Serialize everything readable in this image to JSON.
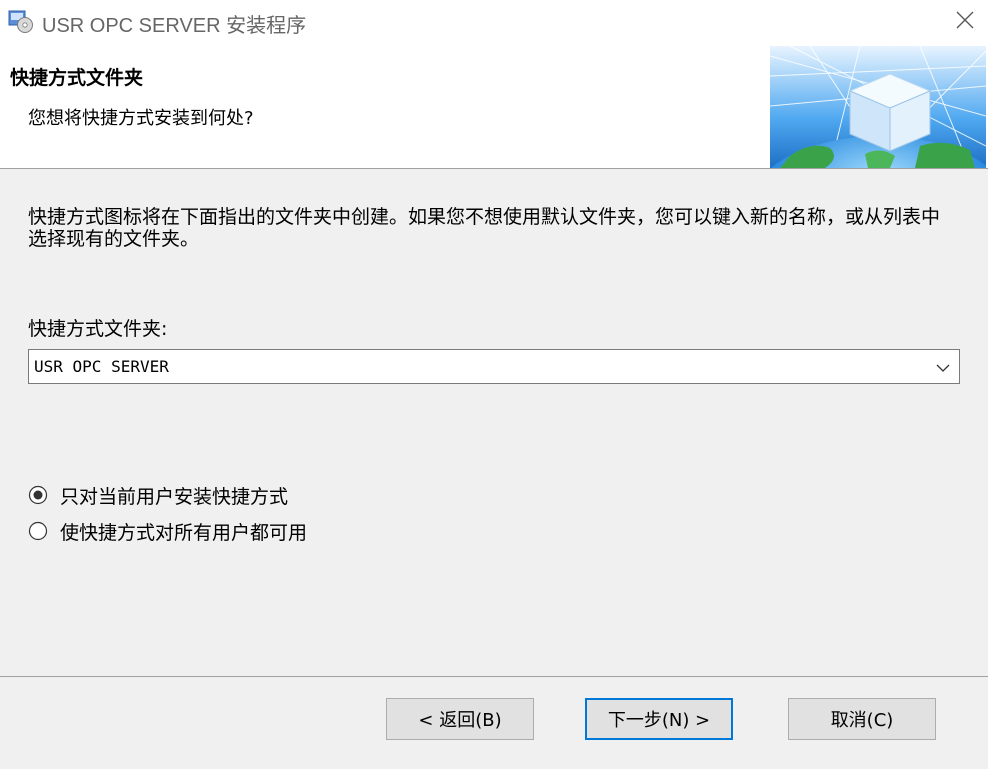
{
  "window": {
    "title": "USR OPC SERVER 安装程序",
    "icon": "installer-app-icon",
    "close_icon": "close-icon"
  },
  "header": {
    "title": "快捷方式文件夹",
    "subtitle": "您想将快捷方式安装到何处?",
    "image": "globe-cube-banner"
  },
  "body": {
    "description": "快捷方式图标将在下面指出的文件夹中创建。如果您不想使用默认文件夹，您可以键入新的名称，或从列表中选择现有的文件夹。",
    "folder_label": "快捷方式文件夹:",
    "folder_value": "USR OPC SERVER",
    "dropdown_icon": "chevron-down-icon",
    "radio_options": [
      {
        "label": "只对当前用户安装快捷方式",
        "selected": true
      },
      {
        "label": "使快捷方式对所有用户都可用",
        "selected": false
      }
    ]
  },
  "buttons": {
    "back": "< 返回(B)",
    "next": "下一步(N) >",
    "cancel": "取消(C)"
  },
  "colors": {
    "dialog_bg": "#f0f0f0",
    "header_bg": "#ffffff",
    "accent": "#0078d7",
    "button_bg": "#e1e1e1"
  }
}
